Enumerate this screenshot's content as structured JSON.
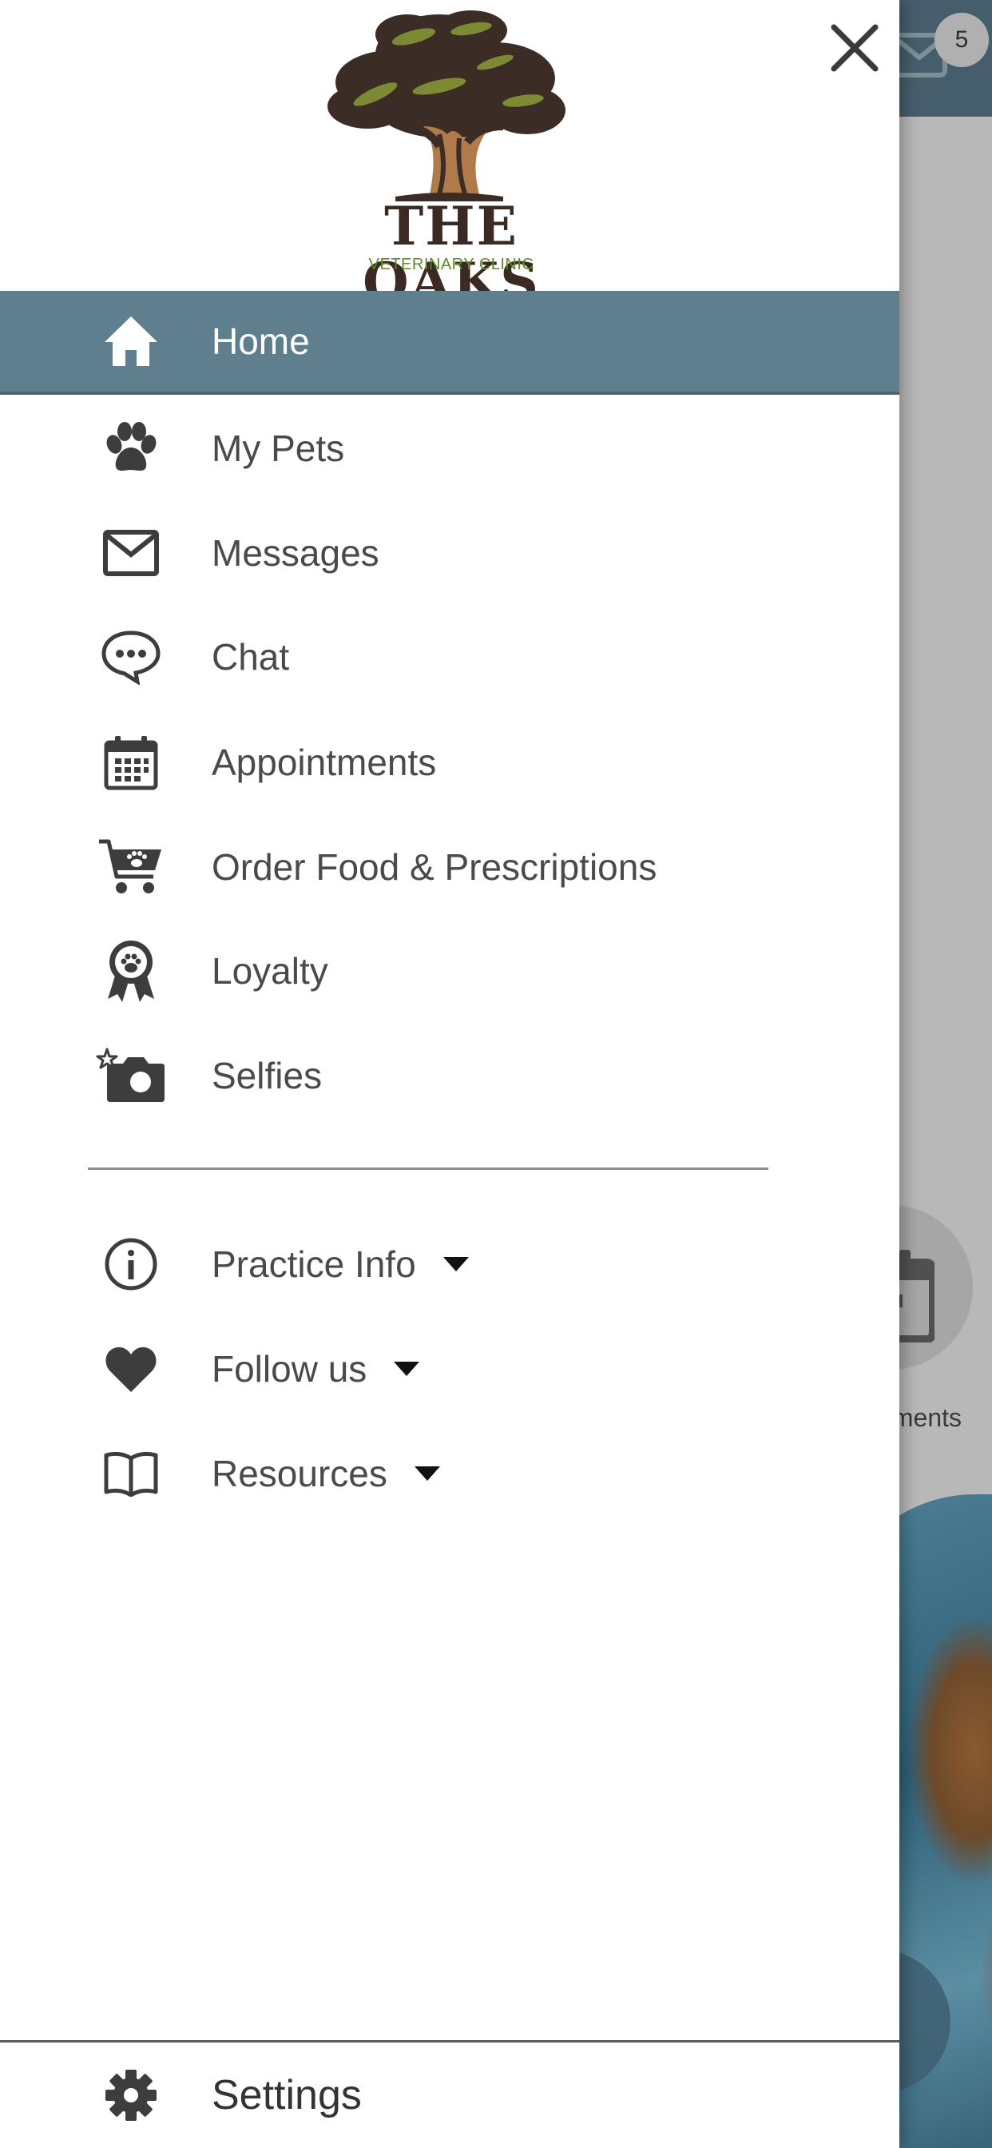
{
  "background": {
    "mail_badge_count": "5",
    "appointments_partial_label": "Appointments"
  },
  "drawer": {
    "logo": {
      "title": "THE OAKS",
      "subtitle": "VETERINARY CLINIC"
    },
    "close_icon": "close-icon",
    "items": [
      {
        "label": "Home",
        "icon": "home-icon",
        "active": true
      },
      {
        "label": "My Pets",
        "icon": "paw-icon"
      },
      {
        "label": "Messages",
        "icon": "envelope-icon"
      },
      {
        "label": "Chat",
        "icon": "chat-bubble-icon"
      },
      {
        "label": "Appointments",
        "icon": "calendar-icon"
      },
      {
        "label": "Order Food & Prescriptions",
        "icon": "cart-paw-icon"
      },
      {
        "label": "Loyalty",
        "icon": "award-ribbon-icon"
      },
      {
        "label": "Selfies",
        "icon": "camera-star-icon"
      }
    ],
    "expandable_items": [
      {
        "label": "Practice Info",
        "icon": "info-icon"
      },
      {
        "label": "Follow us",
        "icon": "heart-icon"
      },
      {
        "label": "Resources",
        "icon": "book-icon"
      }
    ],
    "settings": {
      "label": "Settings",
      "icon": "gear-icon"
    }
  },
  "colors": {
    "active_item_bg": "#5f7f8f",
    "header_bg": "#465e6b",
    "text": "#4a4a4a",
    "logo_green": "#5f8a2a",
    "logo_brown": "#3a2a22"
  }
}
